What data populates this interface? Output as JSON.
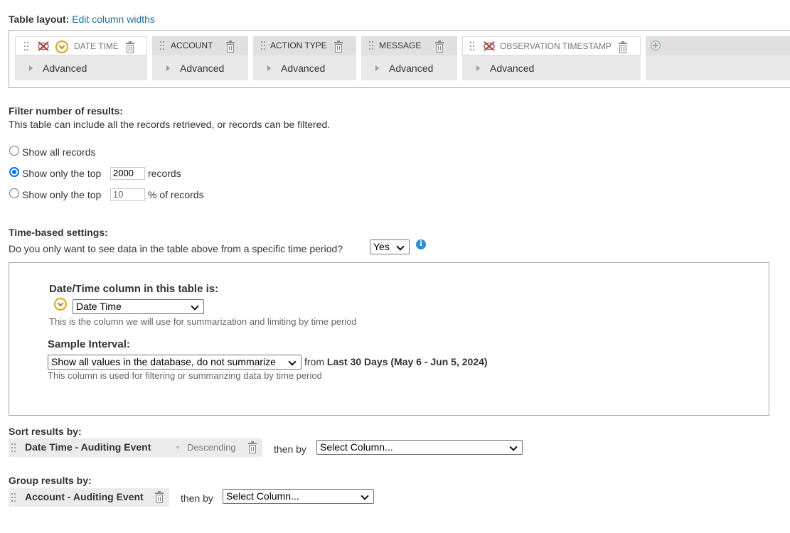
{
  "table_layout": {
    "label": "Table layout:",
    "edit_link": "Edit column widths",
    "columns": [
      {
        "name": "DATE TIME",
        "advanced": "Advanced"
      },
      {
        "name": "ACCOUNT",
        "advanced": "Advanced"
      },
      {
        "name": "ACTION TYPE",
        "advanced": "Advanced"
      },
      {
        "name": "MESSAGE",
        "advanced": "Advanced"
      },
      {
        "name": "OBSERVATION TIMESTAMP",
        "advanced": "Advanced"
      }
    ]
  },
  "filter": {
    "heading": "Filter number of results:",
    "description": "This table can include all the records retrieved, or records can be filtered.",
    "option_all": "Show all records",
    "option_top_prefix": "Show only the top",
    "option_top_value": "2000",
    "option_top_suffix": "records",
    "option_pct_prefix": "Show only the top",
    "option_pct_value": "10",
    "option_pct_suffix": "% of records",
    "selected": "top"
  },
  "time": {
    "heading": "Time-based settings:",
    "question": "Do you only want to see data in the table above from a specific time period?",
    "answer": "Yes",
    "datetime_label": "Date/Time column in this table is:",
    "datetime_value": "Date Time",
    "datetime_help": "This is the column we will use for summarization and limiting by time period",
    "sample_label": "Sample Interval:",
    "sample_value": "Show all values in the database, do not summarize",
    "from_text": "from",
    "range_text": "Last 30 Days (May 6 - Jun 5, 2024)",
    "sample_help": "This column is used for filtering or summarizing data by time period"
  },
  "sort": {
    "heading": "Sort results by:",
    "column": "Date Time - Auditing Event",
    "direction": "Descending",
    "then_by": "then by",
    "select_placeholder": "Select Column..."
  },
  "group": {
    "heading": "Group results by:",
    "column": "Account - Auditing Event",
    "then_by": "then by",
    "select_placeholder": "Select Column..."
  },
  "colors": {
    "link": "#1f6f99",
    "radio": "#0075ff",
    "info": "#2a8fcf",
    "chip_bg": "#ebebeb"
  }
}
